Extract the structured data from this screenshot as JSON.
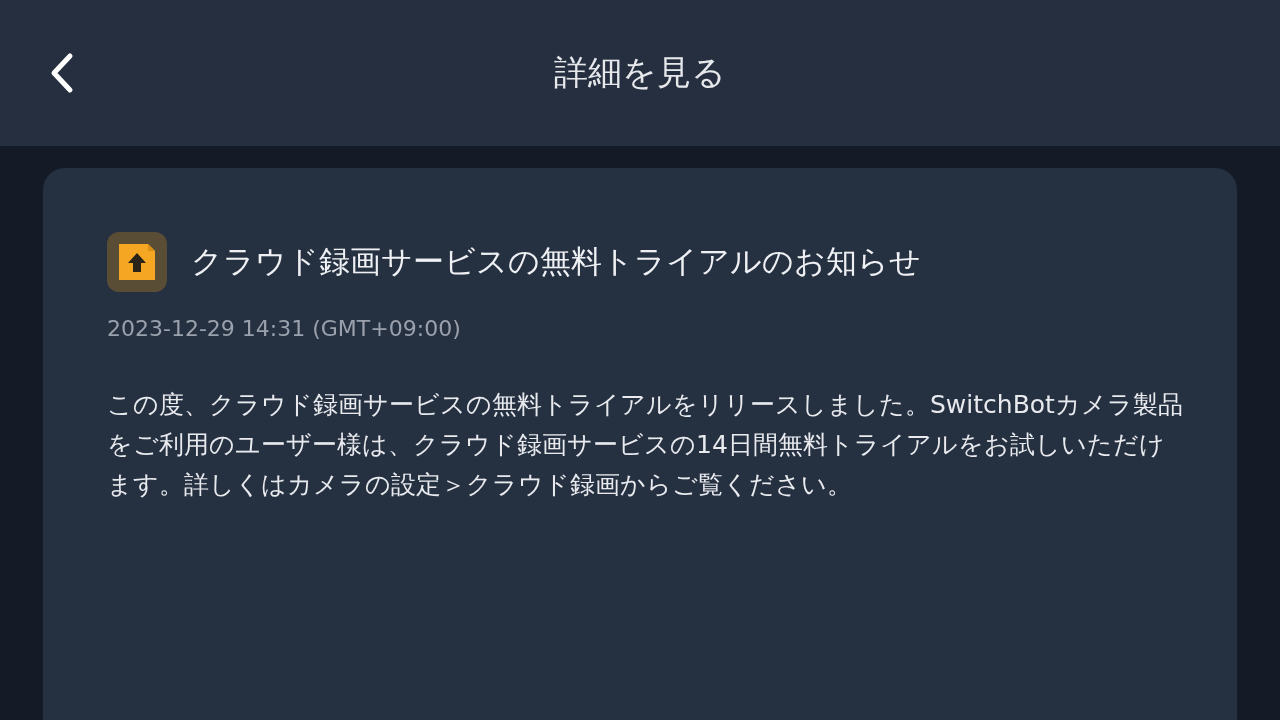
{
  "header": {
    "title": "詳細を見る"
  },
  "notice": {
    "title": "クラウド録画サービスの無料トライアルのお知らせ",
    "timestamp": "2023-12-29 14:31 (GMT+09:00)",
    "body": "この度、クラウド録画サービスの無料トライアルをリリースしました。SwitchBotカメラ製品をご利用のユーザー様は、クラウド録画サービスの14日間無料トライアルをお試しいただけます。詳しくはカメラの設定＞クラウド録画からご覧ください。"
  }
}
